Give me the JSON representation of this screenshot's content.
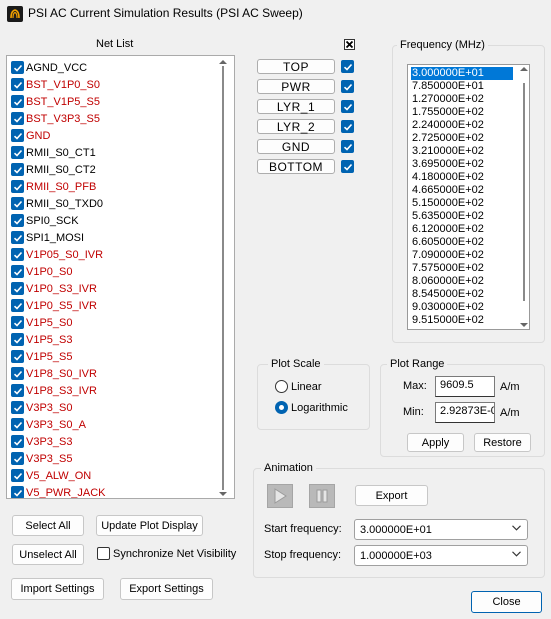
{
  "window": {
    "title": "PSI AC Current Simulation Results (PSI AC Sweep)"
  },
  "netlist": {
    "label": "Net List",
    "items": [
      {
        "name": "AGND_VCC",
        "checked": true,
        "color": "#000000"
      },
      {
        "name": "BST_V1P0_S0",
        "checked": true,
        "color": "#c00000"
      },
      {
        "name": "BST_V1P5_S5",
        "checked": true,
        "color": "#c00000"
      },
      {
        "name": "BST_V3P3_S5",
        "checked": true,
        "color": "#c00000"
      },
      {
        "name": "GND",
        "checked": true,
        "color": "#c00000"
      },
      {
        "name": "RMII_S0_CT1",
        "checked": true,
        "color": "#000000"
      },
      {
        "name": "RMII_S0_CT2",
        "checked": true,
        "color": "#000000"
      },
      {
        "name": "RMII_S0_PFB",
        "checked": true,
        "color": "#c00000"
      },
      {
        "name": "RMII_S0_TXD0",
        "checked": true,
        "color": "#000000"
      },
      {
        "name": "SPI0_SCK",
        "checked": true,
        "color": "#000000"
      },
      {
        "name": "SPI1_MOSI",
        "checked": true,
        "color": "#000000"
      },
      {
        "name": "V1P05_S0_IVR",
        "checked": true,
        "color": "#c00000"
      },
      {
        "name": "V1P0_S0",
        "checked": true,
        "color": "#c00000"
      },
      {
        "name": "V1P0_S3_IVR",
        "checked": true,
        "color": "#c00000"
      },
      {
        "name": "V1P0_S5_IVR",
        "checked": true,
        "color": "#c00000"
      },
      {
        "name": "V1P5_S0",
        "checked": true,
        "color": "#c00000"
      },
      {
        "name": "V1P5_S3",
        "checked": true,
        "color": "#c00000"
      },
      {
        "name": "V1P5_S5",
        "checked": true,
        "color": "#c00000"
      },
      {
        "name": "V1P8_S0_IVR",
        "checked": true,
        "color": "#c00000"
      },
      {
        "name": "V1P8_S3_IVR",
        "checked": true,
        "color": "#c00000"
      },
      {
        "name": "V3P3_S0",
        "checked": true,
        "color": "#c00000"
      },
      {
        "name": "V3P3_S0_A",
        "checked": true,
        "color": "#c00000"
      },
      {
        "name": "V3P3_S3",
        "checked": true,
        "color": "#c00000"
      },
      {
        "name": "V3P3_S5",
        "checked": true,
        "color": "#c00000"
      },
      {
        "name": "V5_ALW_ON",
        "checked": true,
        "color": "#c00000"
      },
      {
        "name": "V5_PWR_JACK",
        "checked": true,
        "color": "#c00000"
      }
    ]
  },
  "layers": [
    {
      "label": "TOP",
      "checked": true
    },
    {
      "label": "PWR",
      "checked": true
    },
    {
      "label": "LYR_1",
      "checked": true
    },
    {
      "label": "LYR_2",
      "checked": true
    },
    {
      "label": "GND",
      "checked": true
    },
    {
      "label": "BOTTOM",
      "checked": true
    }
  ],
  "buttons": {
    "select_all": "Select All",
    "update_plot": "Update Plot Display",
    "unselect_all": "Unselect All",
    "sync_net_visibility": "Synchronize Net Visibility",
    "import_settings": "Import Settings",
    "export_settings": "Export Settings",
    "close": "Close"
  },
  "frequency": {
    "label": "Frequency (MHz)",
    "items": [
      "3.000000E+01",
      "7.850000E+01",
      "1.270000E+02",
      "1.755000E+02",
      "2.240000E+02",
      "2.725000E+02",
      "3.210000E+02",
      "3.695000E+02",
      "4.180000E+02",
      "4.665000E+02",
      "5.150000E+02",
      "5.635000E+02",
      "6.120000E+02",
      "6.605000E+02",
      "7.090000E+02",
      "7.575000E+02",
      "8.060000E+02",
      "8.545000E+02",
      "9.030000E+02",
      "9.515000E+02"
    ],
    "selected_index": 0
  },
  "plot_scale": {
    "label": "Plot Scale",
    "linear": "Linear",
    "logarithmic": "Logarithmic",
    "selected": "Logarithmic"
  },
  "plot_range": {
    "label": "Plot Range",
    "max_label": "Max:",
    "max_value": "9609.5",
    "min_label": "Min:",
    "min_value": "2.92873E-0",
    "unit": "A/m",
    "apply": "Apply",
    "restore": "Restore"
  },
  "animation": {
    "label": "Animation",
    "export": "Export",
    "start_label": "Start frequency:",
    "start_value": "3.000000E+01",
    "stop_label": "Stop frequency:",
    "stop_value": "1.000000E+03"
  }
}
